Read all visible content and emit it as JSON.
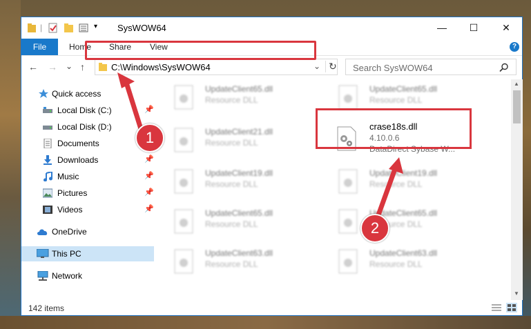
{
  "window": {
    "title": "SysWOW64",
    "minimize_glyph": "—",
    "maximize_glyph": "☐",
    "close_glyph": "✕"
  },
  "ribbon": {
    "file": "File",
    "tabs": [
      "Home",
      "Share",
      "View"
    ],
    "help_glyph": "?"
  },
  "nav": {
    "back_glyph": "←",
    "forward_glyph": "→",
    "recent_glyph": "⌄",
    "up_glyph": "↑",
    "address": "C:\\Windows\\SysWOW64",
    "dropdown_glyph": "⌄",
    "refresh_glyph": "↻",
    "search_placeholder": "Search SysWOW64"
  },
  "sidebar": {
    "items": [
      {
        "label": "Quick access",
        "icon": "star-icon",
        "pinned": false
      },
      {
        "label": "Local Disk (C:)",
        "icon": "drive-icon",
        "pinned": true
      },
      {
        "label": "Local Disk (D:)",
        "icon": "drive-icon",
        "pinned": false
      },
      {
        "label": "Documents",
        "icon": "documents-icon",
        "pinned": true
      },
      {
        "label": "Downloads",
        "icon": "download-icon",
        "pinned": true
      },
      {
        "label": "Music",
        "icon": "music-icon",
        "pinned": true
      },
      {
        "label": "Pictures",
        "icon": "pictures-icon",
        "pinned": true
      },
      {
        "label": "Videos",
        "icon": "videos-icon",
        "pinned": true
      },
      {
        "label": "OneDrive",
        "icon": "cloud-icon",
        "pinned": false
      },
      {
        "label": "This PC",
        "icon": "computer-icon",
        "pinned": false
      },
      {
        "label": "Network",
        "icon": "network-icon",
        "pinned": false
      }
    ],
    "pin_glyph": "📌"
  },
  "files": {
    "left": [
      {
        "name": "UpdateClient65.dll",
        "type": "Resource DLL"
      },
      {
        "name": "UpdateClient21.dll",
        "type": "Resource DLL"
      },
      {
        "name": "UpdateClient19.dll",
        "type": "Resource DLL"
      },
      {
        "name": "UpdateClient65.dll",
        "type": "Resource DLL"
      },
      {
        "name": "UpdateClient63.dll",
        "type": "Resource DLL"
      }
    ],
    "right": [
      {
        "name": "UpdateClient65.dll",
        "type": "Resource DLL"
      },
      {
        "name": "crase18s.dll",
        "version": "4.10.0.6",
        "type": "DataDirect Sybase W..."
      },
      {
        "name": "UpdateClient19.dll",
        "type": "Resource DLL"
      },
      {
        "name": "UpdateClient65.dll",
        "type": "Resource DLL"
      },
      {
        "name": "UpdateClient63.dll",
        "type": "Resource DLL"
      }
    ]
  },
  "status": {
    "count": "142 items"
  },
  "callouts": {
    "one": "1",
    "two": "2"
  },
  "colors": {
    "accent": "#1979ca",
    "highlight": "#d9363e"
  }
}
